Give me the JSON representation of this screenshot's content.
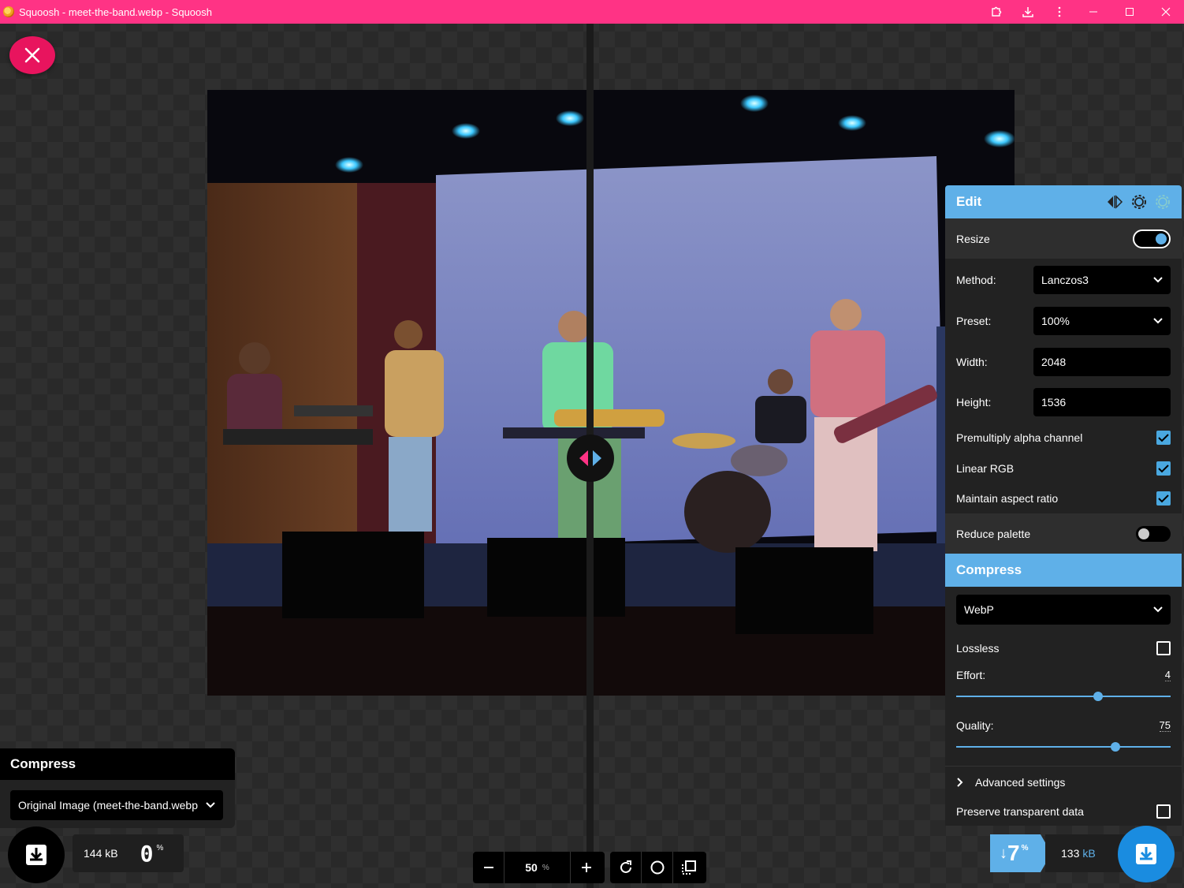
{
  "window": {
    "title": "Squoosh - meet-the-band.webp - Squoosh",
    "icons": [
      "extension-icon",
      "download-icon",
      "more-icon",
      "minimize-icon",
      "maximize-icon",
      "close-icon"
    ]
  },
  "colors": {
    "titlebar": "#ff3385",
    "accent": "#5fb0e8",
    "close": "#e8145e"
  },
  "edit_panel": {
    "title": "Edit",
    "resize": {
      "label": "Resize",
      "enabled": true
    },
    "method": {
      "label": "Method:",
      "value": "Lanczos3"
    },
    "preset": {
      "label": "Preset:",
      "value": "100%"
    },
    "width": {
      "label": "Width:",
      "value": "2048"
    },
    "height": {
      "label": "Height:",
      "value": "1536"
    },
    "premultiply": {
      "label": "Premultiply alpha channel",
      "checked": true
    },
    "linear_rgb": {
      "label": "Linear RGB",
      "checked": true
    },
    "aspect": {
      "label": "Maintain aspect ratio",
      "checked": true
    },
    "reduce_palette": {
      "label": "Reduce palette",
      "enabled": false
    }
  },
  "compress_panel": {
    "title": "Compress",
    "codec": "WebP",
    "lossless": {
      "label": "Lossless",
      "checked": false
    },
    "effort": {
      "label": "Effort:",
      "value": "4",
      "fraction": 0.667
    },
    "quality": {
      "label": "Quality:",
      "value": "75",
      "fraction": 0.75
    },
    "advanced": "Advanced settings",
    "preserve": {
      "label": "Preserve transparent data",
      "checked": false
    }
  },
  "left_panel": {
    "title": "Compress",
    "select": "Original Image (meet-the-band.webp)",
    "size": "144 kB",
    "percent": "0",
    "pct_sign": "%"
  },
  "right_result": {
    "arrow": "↓",
    "percent": "7",
    "pct_sign": "%",
    "size": "133",
    "unit": "kB"
  },
  "zoom": {
    "value": "50",
    "unit": "%"
  }
}
